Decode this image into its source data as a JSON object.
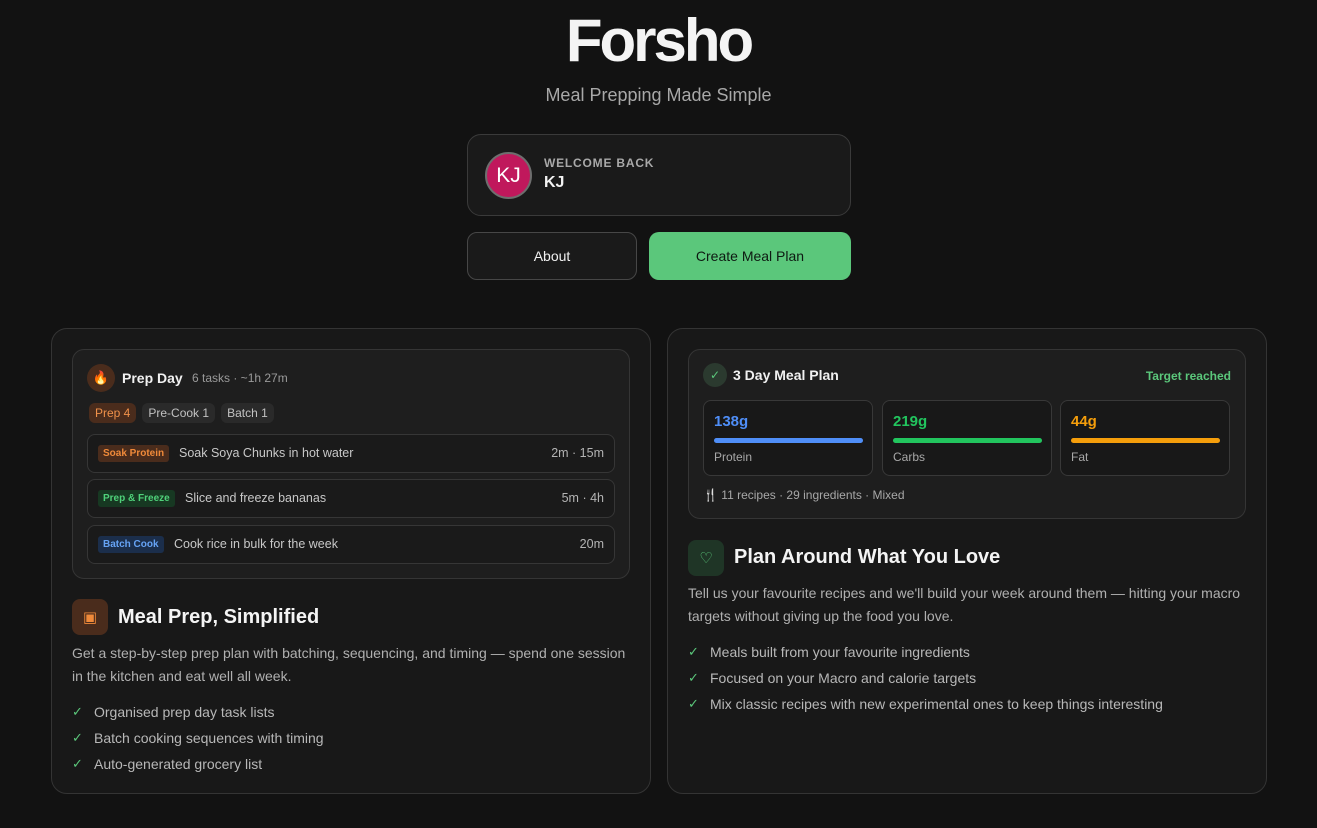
{
  "brand": {
    "name": "Forsho",
    "tagline": "Meal Prepping Made Simple"
  },
  "user": {
    "initials": "KJ",
    "greeting": "WELCOME BACK",
    "name": "KJ",
    "avatar_color": "#c0185c"
  },
  "actions": {
    "about_label": "About",
    "create_label": "Create Meal Plan"
  },
  "prep_card": {
    "title": "Prep Day",
    "meta": "6 tasks · ~1h 27m",
    "chips": [
      "Prep 4",
      "Pre-Cook 1",
      "Batch 1"
    ],
    "tasks": [
      {
        "tag": "Soak Protein",
        "text": "Soak Soya Chunks in hot water",
        "time": "2m · 15m"
      },
      {
        "tag": "Prep & Freeze",
        "text": "Slice and freeze bananas",
        "time": "5m · 4h"
      },
      {
        "tag": "Batch Cook",
        "text": "Cook rice in bulk for the week",
        "time": "20m"
      }
    ],
    "feature_title": "Meal Prep, Simplified",
    "feature_desc": "Get a step-by-step prep plan with batching, sequencing, and timing — spend one session in the kitchen and eat well all week.",
    "features": [
      "Organised prep day task lists",
      "Batch cooking sequences with timing",
      "Auto-generated grocery list"
    ]
  },
  "plan_card": {
    "title": "3 Day Meal Plan",
    "status": "Target reached",
    "macros": [
      {
        "value": "138g",
        "label": "Protein",
        "color": "#4f8ef7"
      },
      {
        "value": "219g",
        "label": "Carbs",
        "color": "#22c55e"
      },
      {
        "value": "44g",
        "label": "Fat",
        "color": "#f59e0b"
      }
    ],
    "summary": "11 recipes · 29 ingredients · Mixed",
    "feature_title": "Plan Around What You Love",
    "feature_desc": "Tell us your favourite recipes and we'll build your week around them — hitting your macro targets without giving up the food you love.",
    "features": [
      "Meals built from your favourite ingredients",
      "Focused on your Macro and calorie targets",
      "Mix classic recipes with new experimental ones to keep things interesting"
    ]
  }
}
